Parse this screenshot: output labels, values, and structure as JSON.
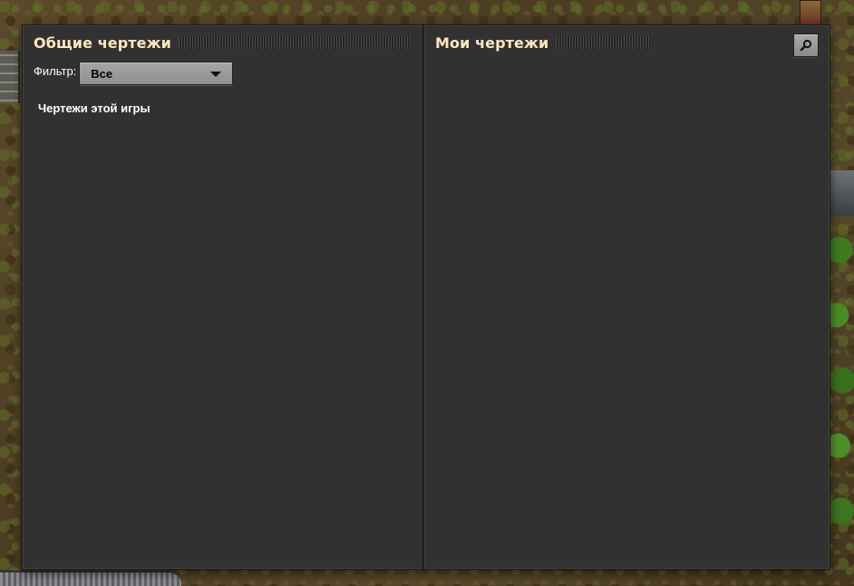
{
  "left_panel": {
    "title": "Общие чертежи",
    "filter": {
      "label": "Фильтр:",
      "selected": "Все"
    },
    "section_label": "Чертежи этой игры"
  },
  "right_panel": {
    "title": "Мои чертежи",
    "search_icon": "search-icon"
  },
  "colors": {
    "title": "#ffe6c0",
    "panel_bg": "#313131",
    "button_bg": "#9b9b9b"
  }
}
